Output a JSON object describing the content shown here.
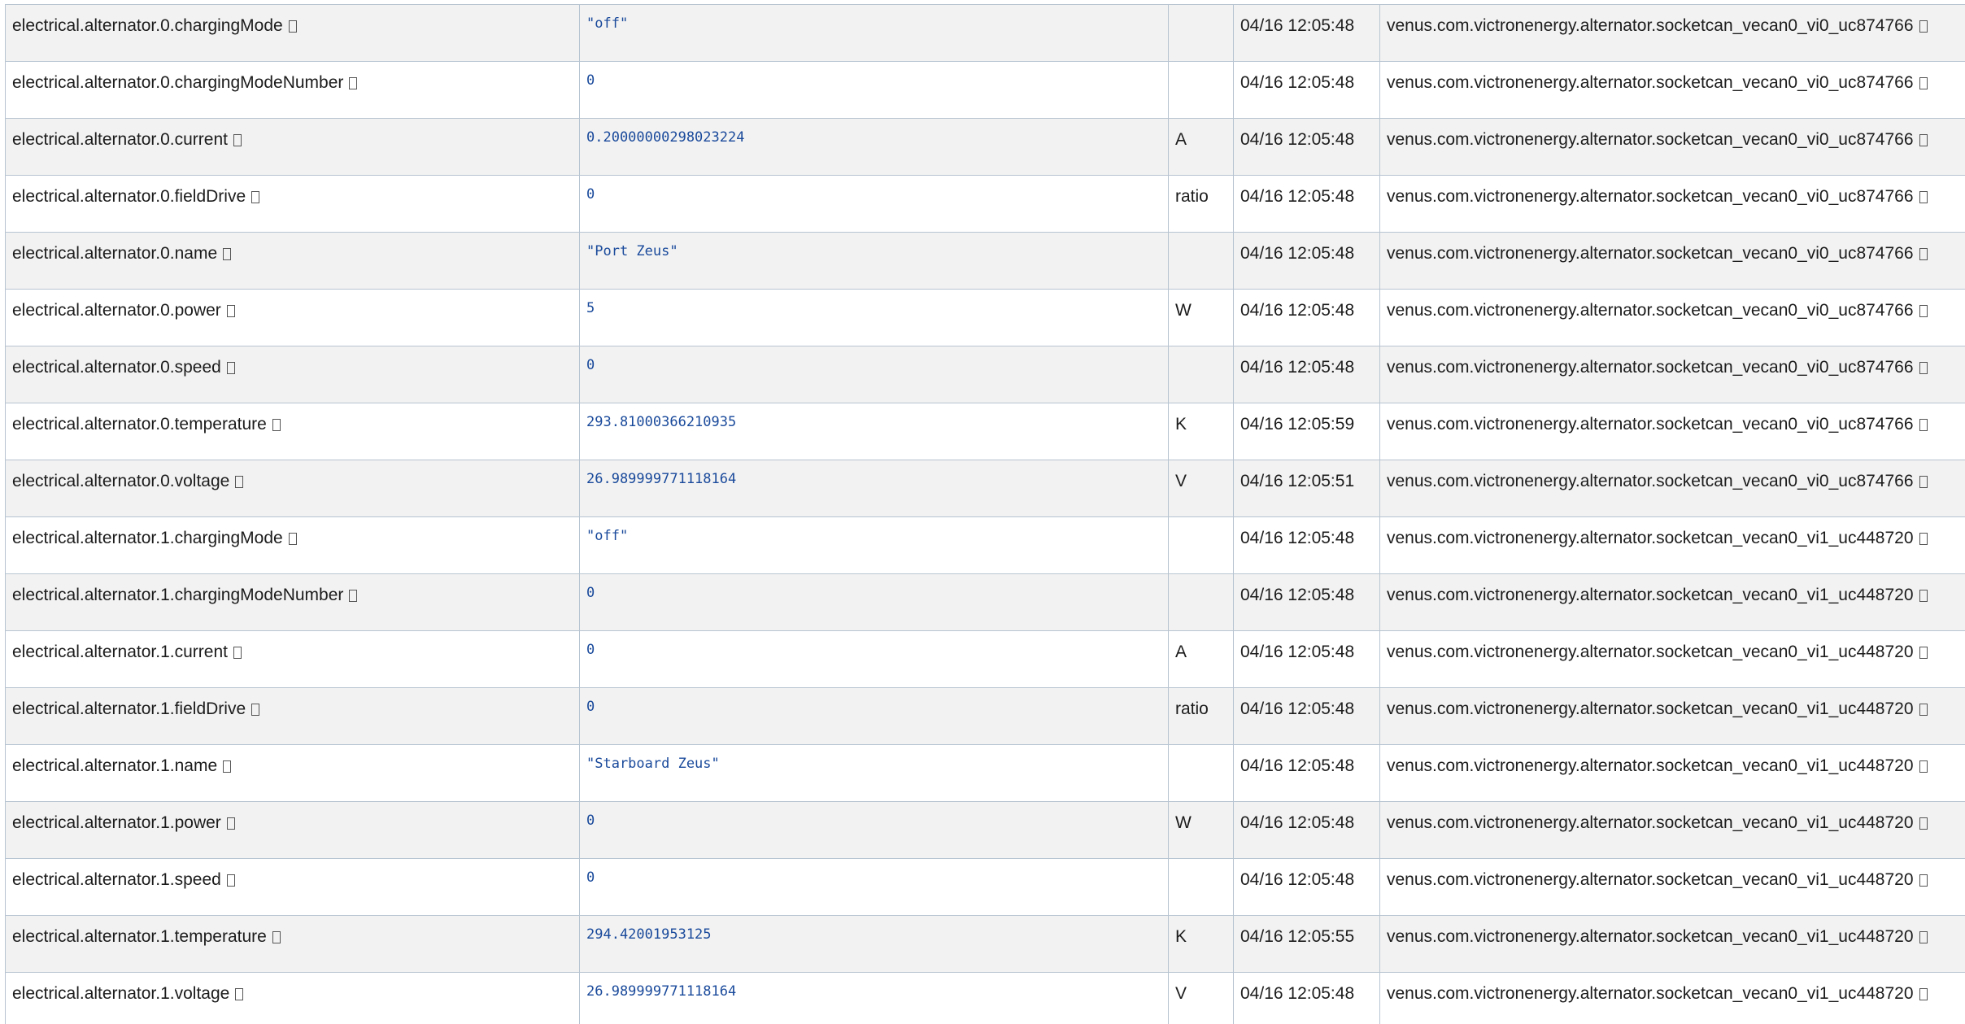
{
  "rows": [
    {
      "path": "electrical.alternator.0.chargingMode",
      "value": "\"off\"",
      "units": "",
      "timestamp": "04/16 12:05:48",
      "source": "venus.com.victronenergy.alternator.socketcan_vecan0_vi0_uc874766"
    },
    {
      "path": "electrical.alternator.0.chargingModeNumber",
      "value": "0",
      "units": "",
      "timestamp": "04/16 12:05:48",
      "source": "venus.com.victronenergy.alternator.socketcan_vecan0_vi0_uc874766"
    },
    {
      "path": "electrical.alternator.0.current",
      "value": "0.20000000298023224",
      "units": "A",
      "timestamp": "04/16 12:05:48",
      "source": "venus.com.victronenergy.alternator.socketcan_vecan0_vi0_uc874766"
    },
    {
      "path": "electrical.alternator.0.fieldDrive",
      "value": "0",
      "units": "ratio",
      "timestamp": "04/16 12:05:48",
      "source": "venus.com.victronenergy.alternator.socketcan_vecan0_vi0_uc874766"
    },
    {
      "path": "electrical.alternator.0.name",
      "value": "\"Port Zeus\"",
      "units": "",
      "timestamp": "04/16 12:05:48",
      "source": "venus.com.victronenergy.alternator.socketcan_vecan0_vi0_uc874766"
    },
    {
      "path": "electrical.alternator.0.power",
      "value": "5",
      "units": "W",
      "timestamp": "04/16 12:05:48",
      "source": "venus.com.victronenergy.alternator.socketcan_vecan0_vi0_uc874766"
    },
    {
      "path": "electrical.alternator.0.speed",
      "value": "0",
      "units": "",
      "timestamp": "04/16 12:05:48",
      "source": "venus.com.victronenergy.alternator.socketcan_vecan0_vi0_uc874766"
    },
    {
      "path": "electrical.alternator.0.temperature",
      "value": "293.81000366210935",
      "units": "K",
      "timestamp": "04/16 12:05:59",
      "source": "venus.com.victronenergy.alternator.socketcan_vecan0_vi0_uc874766"
    },
    {
      "path": "electrical.alternator.0.voltage",
      "value": "26.989999771118164",
      "units": "V",
      "timestamp": "04/16 12:05:51",
      "source": "venus.com.victronenergy.alternator.socketcan_vecan0_vi0_uc874766"
    },
    {
      "path": "electrical.alternator.1.chargingMode",
      "value": "\"off\"",
      "units": "",
      "timestamp": "04/16 12:05:48",
      "source": "venus.com.victronenergy.alternator.socketcan_vecan0_vi1_uc448720"
    },
    {
      "path": "electrical.alternator.1.chargingModeNumber",
      "value": "0",
      "units": "",
      "timestamp": "04/16 12:05:48",
      "source": "venus.com.victronenergy.alternator.socketcan_vecan0_vi1_uc448720"
    },
    {
      "path": "electrical.alternator.1.current",
      "value": "0",
      "units": "A",
      "timestamp": "04/16 12:05:48",
      "source": "venus.com.victronenergy.alternator.socketcan_vecan0_vi1_uc448720"
    },
    {
      "path": "electrical.alternator.1.fieldDrive",
      "value": "0",
      "units": "ratio",
      "timestamp": "04/16 12:05:48",
      "source": "venus.com.victronenergy.alternator.socketcan_vecan0_vi1_uc448720"
    },
    {
      "path": "electrical.alternator.1.name",
      "value": "\"Starboard Zeus\"",
      "units": "",
      "timestamp": "04/16 12:05:48",
      "source": "venus.com.victronenergy.alternator.socketcan_vecan0_vi1_uc448720"
    },
    {
      "path": "electrical.alternator.1.power",
      "value": "0",
      "units": "W",
      "timestamp": "04/16 12:05:48",
      "source": "venus.com.victronenergy.alternator.socketcan_vecan0_vi1_uc448720"
    },
    {
      "path": "electrical.alternator.1.speed",
      "value": "0",
      "units": "",
      "timestamp": "04/16 12:05:48",
      "source": "venus.com.victronenergy.alternator.socketcan_vecan0_vi1_uc448720"
    },
    {
      "path": "electrical.alternator.1.temperature",
      "value": "294.42001953125",
      "units": "K",
      "timestamp": "04/16 12:05:55",
      "source": "venus.com.victronenergy.alternator.socketcan_vecan0_vi1_uc448720"
    },
    {
      "path": "electrical.alternator.1.voltage",
      "value": "26.989999771118164",
      "units": "V",
      "timestamp": "04/16 12:05:48",
      "source": "venus.com.victronenergy.alternator.socketcan_vecan0_vi1_uc448720"
    }
  ]
}
